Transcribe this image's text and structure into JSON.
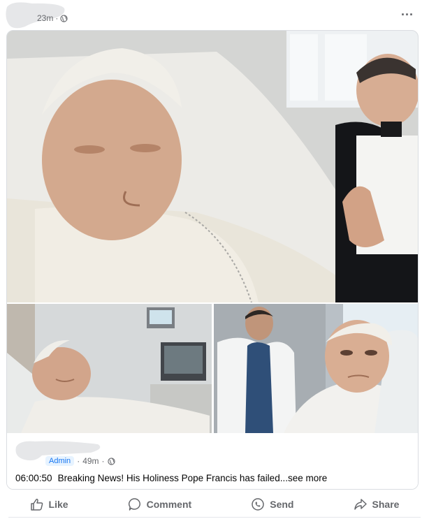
{
  "header": {
    "time": "23m",
    "privacy_icon": "globe-icon",
    "more_icon": "more-options-icon",
    "more_label": "..."
  },
  "shared_post": {
    "admin_badge": "Admin",
    "time": "49m",
    "privacy_icon": "globe-icon",
    "timestamp": "06:00:50",
    "text": "Breaking News! His Holiness Pope Francis has failed",
    "see_more": "...see more",
    "images": [
      {
        "name": "photo-main"
      },
      {
        "name": "photo-bottom-left"
      },
      {
        "name": "photo-bottom-right"
      }
    ]
  },
  "actions": {
    "like": {
      "label": "Like",
      "icon": "thumbs-up-icon"
    },
    "comment": {
      "label": "Comment",
      "icon": "comment-icon"
    },
    "send": {
      "label": "Send",
      "icon": "messenger-icon"
    },
    "share": {
      "label": "Share",
      "icon": "share-icon"
    }
  },
  "colors": {
    "secondary_text": "#65676b",
    "badge_text": "#1877f2",
    "badge_bg": "#e7f3ff",
    "divider": "#e4e6eb"
  }
}
